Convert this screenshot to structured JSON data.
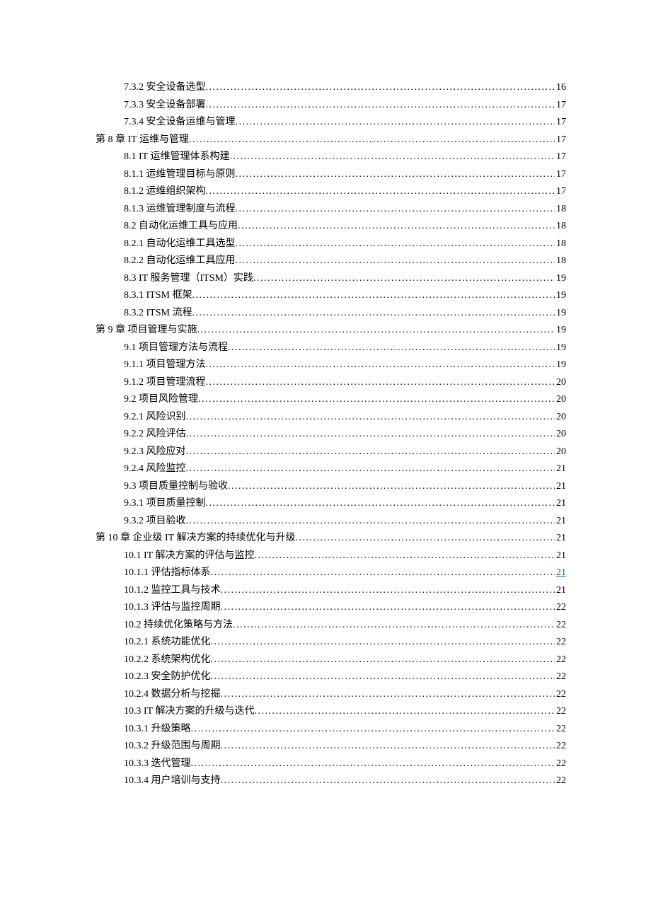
{
  "toc": [
    {
      "level": 1,
      "title": "7.3.2 安全设备选型",
      "page": "16",
      "link": false
    },
    {
      "level": 1,
      "title": "7.3.3 安全设备部署",
      "page": "17",
      "link": false
    },
    {
      "level": 1,
      "title": "7.3.4 安全设备运维与管理",
      "page": "17",
      "link": false
    },
    {
      "level": 0,
      "title": "第 8 章 IT 运维与管理",
      "page": "17",
      "link": false
    },
    {
      "level": 1,
      "title": "8.1 IT 运维管理体系构建",
      "page": "17",
      "link": false
    },
    {
      "level": 1,
      "title": "8.1.1 运维管理目标与原则",
      "page": "17",
      "link": false
    },
    {
      "level": 1,
      "title": "8.1.2 运维组织架构",
      "page": "17",
      "link": false
    },
    {
      "level": 1,
      "title": "8.1.3 运维管理制度与流程",
      "page": "18",
      "link": false
    },
    {
      "level": 1,
      "title": "8.2 自动化运维工具与应用",
      "page": "18",
      "link": false
    },
    {
      "level": 1,
      "title": "8.2.1 自动化运维工具选型",
      "page": "18",
      "link": false
    },
    {
      "level": 1,
      "title": "8.2.2 自动化运维工具应用",
      "page": "18",
      "link": false
    },
    {
      "level": 1,
      "title": "8.3 IT 服务管理（ITSM）实践",
      "page": "19",
      "link": false
    },
    {
      "level": 1,
      "title": "8.3.1 ITSM 框架",
      "page": "19",
      "link": false
    },
    {
      "level": 1,
      "title": "8.3.2 ITSM 流程",
      "page": "19",
      "link": false
    },
    {
      "level": 0,
      "title": "第 9 章 项目管理与实施",
      "page": "19",
      "link": false
    },
    {
      "level": 1,
      "title": "9.1 项目管理方法与流程",
      "page": "19",
      "link": false
    },
    {
      "level": 1,
      "title": "9.1.1 项目管理方法",
      "page": "19",
      "link": false
    },
    {
      "level": 1,
      "title": "9.1.2 项目管理流程",
      "page": "20",
      "link": false
    },
    {
      "level": 1,
      "title": "9.2 项目风险管理",
      "page": "20",
      "link": false
    },
    {
      "level": 1,
      "title": "9.2.1 风险识别 ",
      "page": "20",
      "link": false
    },
    {
      "level": 1,
      "title": "9.2.2 风险评估 ",
      "page": "20",
      "link": false
    },
    {
      "level": 1,
      "title": "9.2.3 风险应对 ",
      "page": "20",
      "link": false
    },
    {
      "level": 1,
      "title": "9.2.4 风险监控 ",
      "page": "21",
      "link": false
    },
    {
      "level": 1,
      "title": "9.3 项目质量控制与验收",
      "page": "21",
      "link": false
    },
    {
      "level": 1,
      "title": "9.3.1 项目质量控制",
      "page": "21",
      "link": false
    },
    {
      "level": 1,
      "title": "9.3.2 项目验收 ",
      "page": "21",
      "link": false
    },
    {
      "level": 0,
      "title": "第 10 章 企业级 IT 解决方案的持续优化与升级 ",
      "page": "21",
      "link": false
    },
    {
      "level": 1,
      "title": "10.1 IT 解决方案的评估与监控",
      "page": "21",
      "link": false
    },
    {
      "level": 1,
      "title": "10.1.1 评估指标体系",
      "page": "21",
      "link": true
    },
    {
      "level": 1,
      "title": "10.1.2 监控工具与技术",
      "page": "21",
      "link": false
    },
    {
      "level": 1,
      "title": "10.1.3 评估与监控周期",
      "page": "22",
      "link": false
    },
    {
      "level": 1,
      "title": "10.2 持续优化策略与方法",
      "page": "22",
      "link": false
    },
    {
      "level": 1,
      "title": "10.2.1 系统功能优化",
      "page": "22",
      "link": false
    },
    {
      "level": 1,
      "title": "10.2.2 系统架构优化",
      "page": "22",
      "link": false
    },
    {
      "level": 1,
      "title": "10.2.3 安全防护优化",
      "page": "22",
      "link": false
    },
    {
      "level": 1,
      "title": "10.2.4 数据分析与挖掘",
      "page": "22",
      "link": false
    },
    {
      "level": 1,
      "title": "10.3 IT 解决方案的升级与迭代",
      "page": "22",
      "link": false
    },
    {
      "level": 1,
      "title": "10.3.1 升级策略",
      "page": "22",
      "link": false
    },
    {
      "level": 1,
      "title": "10.3.2 升级范围与周期",
      "page": "22",
      "link": false
    },
    {
      "level": 1,
      "title": "10.3.3 迭代管理",
      "page": "22",
      "link": false
    },
    {
      "level": 1,
      "title": "10.3.4 用户培训与支持",
      "page": "22",
      "link": false
    }
  ]
}
